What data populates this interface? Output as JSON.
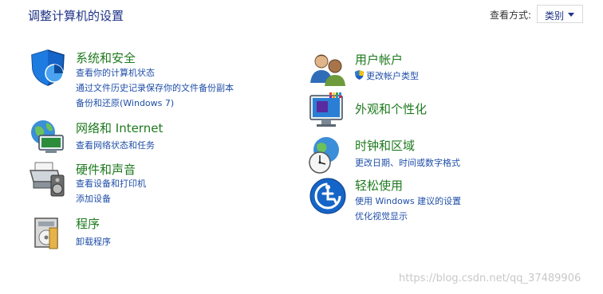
{
  "header": {
    "title": "调整计算机的设置"
  },
  "view_by": {
    "label": "查看方式:",
    "selected": "类别"
  },
  "left": [
    {
      "id": "system-security",
      "icon": "shield-icon",
      "title": "系统和安全",
      "links": [
        "查看你的计算机状态",
        "通过文件历史记录保存你的文件备份副本",
        "备份和还原(Windows 7)"
      ]
    },
    {
      "id": "network-internet",
      "icon": "network-globe-icon",
      "title": "网络和 Internet",
      "links": [
        "查看网络状态和任务"
      ]
    },
    {
      "id": "hardware-sound",
      "icon": "printer-speaker-icon",
      "title": "硬件和声音",
      "links": [
        "查看设备和打印机",
        "添加设备"
      ]
    },
    {
      "id": "programs",
      "icon": "programs-disk-icon",
      "title": "程序",
      "links": [
        "卸载程序"
      ]
    }
  ],
  "right": [
    {
      "id": "user-accounts",
      "icon": "users-icon",
      "title": "用户帐户",
      "links": [
        "更改帐户类型"
      ],
      "link_icon": "uac-shield-icon"
    },
    {
      "id": "appearance",
      "icon": "monitor-colors-icon",
      "title": "外观和个性化",
      "links": []
    },
    {
      "id": "clock-region",
      "icon": "clock-globe-icon",
      "title": "时钟和区域",
      "links": [
        "更改日期、时间或数字格式"
      ]
    },
    {
      "id": "ease-of-access",
      "icon": "accessibility-icon",
      "title": "轻松使用",
      "links": [
        "使用 Windows 建议的设置",
        "优化视觉显示"
      ]
    }
  ],
  "watermark": "https://blog.csdn.net/qq_37489906",
  "colors": {
    "title": "#1e3287",
    "category_heading": "#1e7a1e",
    "link": "#1f4ea8"
  }
}
